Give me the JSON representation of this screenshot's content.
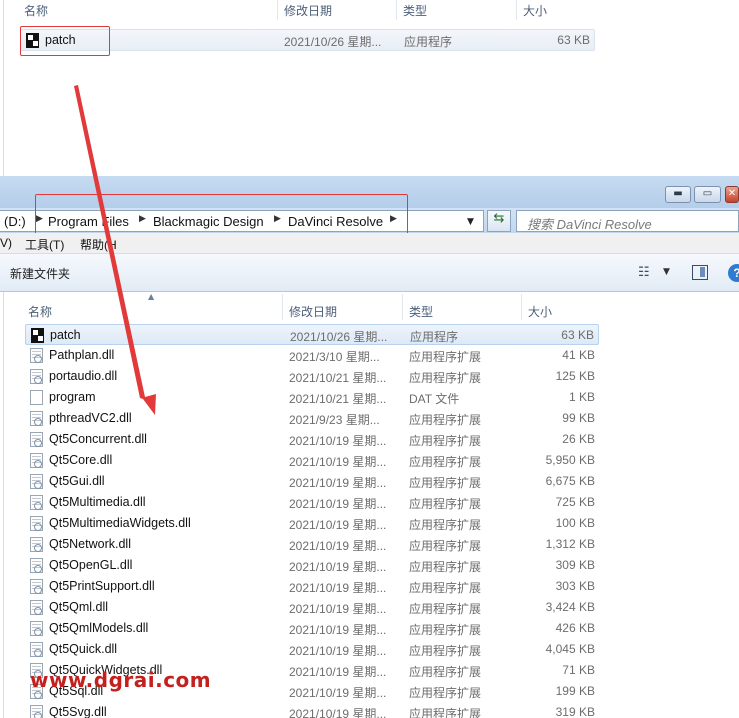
{
  "top_pane": {
    "columns": {
      "name": "名称",
      "date": "修改日期",
      "type": "类型",
      "size": "大小"
    },
    "row": {
      "name": "patch",
      "date": "2021/10/26 星期...",
      "type": "应用程序",
      "size": "63 KB",
      "icon": "exe-icon"
    }
  },
  "window": {
    "controls": {
      "minimize": "▬",
      "maximize": "▭",
      "close": "✕"
    },
    "address": {
      "drive": "(D:)",
      "crumbs": [
        "Program Files",
        "Blackmagic Design",
        "DaVinci Resolve"
      ],
      "search_placeholder": "搜索 DaVinci Resolve"
    },
    "menu": {
      "partial": "V)",
      "tools": "工具(T)",
      "help": "帮助(H"
    },
    "toolbar": {
      "new_folder": "新建文件夹",
      "help_glyph": "?"
    },
    "columns": {
      "name": "名称",
      "date": "修改日期",
      "type": "类型",
      "size": "大小"
    },
    "files": [
      {
        "name": "patch",
        "date": "2021/10/26 星期...",
        "type": "应用程序",
        "size": "63 KB",
        "icon": "exe-icon",
        "selected": true
      },
      {
        "name": "Pathplan.dll",
        "date": "2021/3/10 星期...",
        "type": "应用程序扩展",
        "size": "41 KB",
        "icon": "dll-icon"
      },
      {
        "name": "portaudio.dll",
        "date": "2021/10/21 星期...",
        "type": "应用程序扩展",
        "size": "125 KB",
        "icon": "dll-icon"
      },
      {
        "name": "program",
        "date": "2021/10/21 星期...",
        "type": "DAT 文件",
        "size": "1 KB",
        "icon": "dat-file-icon"
      },
      {
        "name": "pthreadVC2.dll",
        "date": "2021/9/23 星期...",
        "type": "应用程序扩展",
        "size": "99 KB",
        "icon": "dll-icon"
      },
      {
        "name": "Qt5Concurrent.dll",
        "date": "2021/10/19 星期...",
        "type": "应用程序扩展",
        "size": "26 KB",
        "icon": "dll-icon"
      },
      {
        "name": "Qt5Core.dll",
        "date": "2021/10/19 星期...",
        "type": "应用程序扩展",
        "size": "5,950 KB",
        "icon": "dll-icon"
      },
      {
        "name": "Qt5Gui.dll",
        "date": "2021/10/19 星期...",
        "type": "应用程序扩展",
        "size": "6,675 KB",
        "icon": "dll-icon"
      },
      {
        "name": "Qt5Multimedia.dll",
        "date": "2021/10/19 星期...",
        "type": "应用程序扩展",
        "size": "725 KB",
        "icon": "dll-icon"
      },
      {
        "name": "Qt5MultimediaWidgets.dll",
        "date": "2021/10/19 星期...",
        "type": "应用程序扩展",
        "size": "100 KB",
        "icon": "dll-icon"
      },
      {
        "name": "Qt5Network.dll",
        "date": "2021/10/19 星期...",
        "type": "应用程序扩展",
        "size": "1,312 KB",
        "icon": "dll-icon"
      },
      {
        "name": "Qt5OpenGL.dll",
        "date": "2021/10/19 星期...",
        "type": "应用程序扩展",
        "size": "309 KB",
        "icon": "dll-icon"
      },
      {
        "name": "Qt5PrintSupport.dll",
        "date": "2021/10/19 星期...",
        "type": "应用程序扩展",
        "size": "303 KB",
        "icon": "dll-icon"
      },
      {
        "name": "Qt5Qml.dll",
        "date": "2021/10/19 星期...",
        "type": "应用程序扩展",
        "size": "3,424 KB",
        "icon": "dll-icon"
      },
      {
        "name": "Qt5QmlModels.dll",
        "date": "2021/10/19 星期...",
        "type": "应用程序扩展",
        "size": "426 KB",
        "icon": "dll-icon"
      },
      {
        "name": "Qt5Quick.dll",
        "date": "2021/10/19 星期...",
        "type": "应用程序扩展",
        "size": "4,045 KB",
        "icon": "dll-icon"
      },
      {
        "name": "Qt5QuickWidgets.dll",
        "date": "2021/10/19 星期...",
        "type": "应用程序扩展",
        "size": "71 KB",
        "icon": "dll-icon"
      },
      {
        "name": "Qt5Sql.dll",
        "date": "2021/10/19 星期...",
        "type": "应用程序扩展",
        "size": "199 KB",
        "icon": "dll-icon"
      },
      {
        "name": "Qt5Svg.dll",
        "date": "2021/10/19 星期...",
        "type": "应用程序扩展",
        "size": "319 KB",
        "icon": "dll-icon"
      }
    ]
  },
  "annotation": {
    "color": "#e23a3a"
  },
  "watermark": "www.dgrai.com"
}
